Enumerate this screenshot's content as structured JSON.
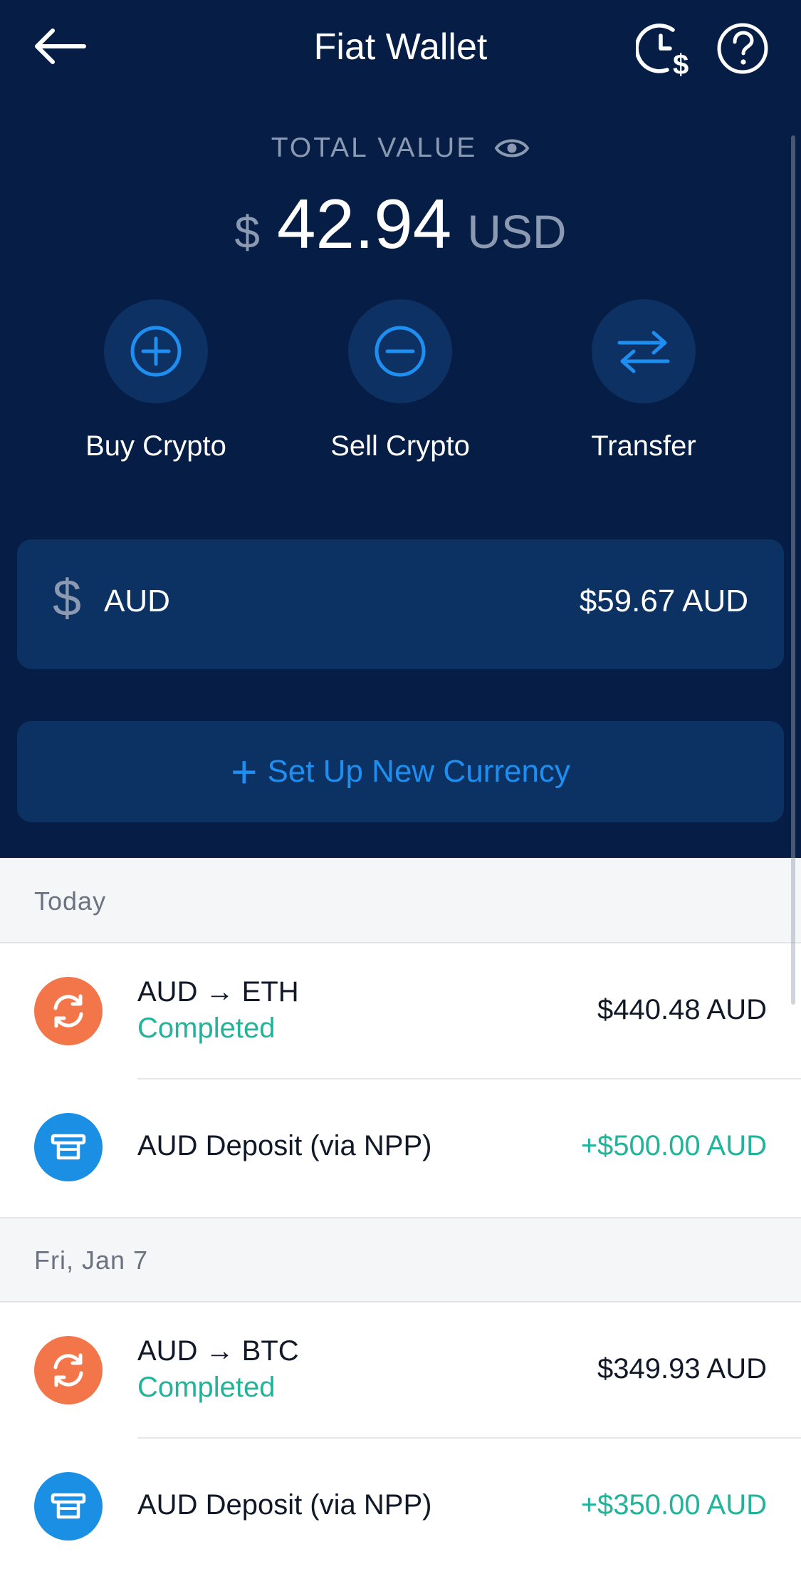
{
  "header": {
    "title": "Fiat Wallet",
    "back_icon": "arrow-left-icon",
    "history_icon": "clock-dollar-icon",
    "help_icon": "question-circle-icon"
  },
  "total": {
    "label": "TOTAL VALUE",
    "visibility_icon": "eye-icon",
    "symbol": "$",
    "amount": "42.94",
    "currency": "USD"
  },
  "actions": [
    {
      "label": "Buy Crypto",
      "icon": "plus-circle-icon"
    },
    {
      "label": "Sell Crypto",
      "icon": "minus-circle-icon"
    },
    {
      "label": "Transfer",
      "icon": "transfer-arrows-icon"
    }
  ],
  "wallet": {
    "symbol": "$",
    "currency": "AUD",
    "balance": "$59.67 AUD"
  },
  "new_currency": {
    "plus": "+",
    "label": "Set Up New Currency"
  },
  "sections": [
    {
      "date": "Today",
      "transactions": [
        {
          "title": "AUD → ETH",
          "status": "Completed",
          "amount": "$440.48 AUD",
          "icon": "exchange-icon"
        },
        {
          "title": "AUD Deposit (via NPP)",
          "amount": "+$500.00 AUD",
          "icon": "bank-deposit-icon"
        }
      ]
    },
    {
      "date": "Fri, Jan 7",
      "transactions": [
        {
          "title": "AUD → BTC",
          "status": "Completed",
          "amount": "$349.93 AUD",
          "icon": "exchange-icon"
        },
        {
          "title": "AUD Deposit (via NPP)",
          "amount": "+$350.00 AUD",
          "icon": "bank-deposit-icon"
        }
      ]
    }
  ],
  "colors": {
    "header_bg": "#061e45",
    "card_bg": "#0b3263",
    "accent_blue": "#1e8ff0",
    "positive_green": "#22b49a",
    "exchange_orange": "#f3764b"
  }
}
